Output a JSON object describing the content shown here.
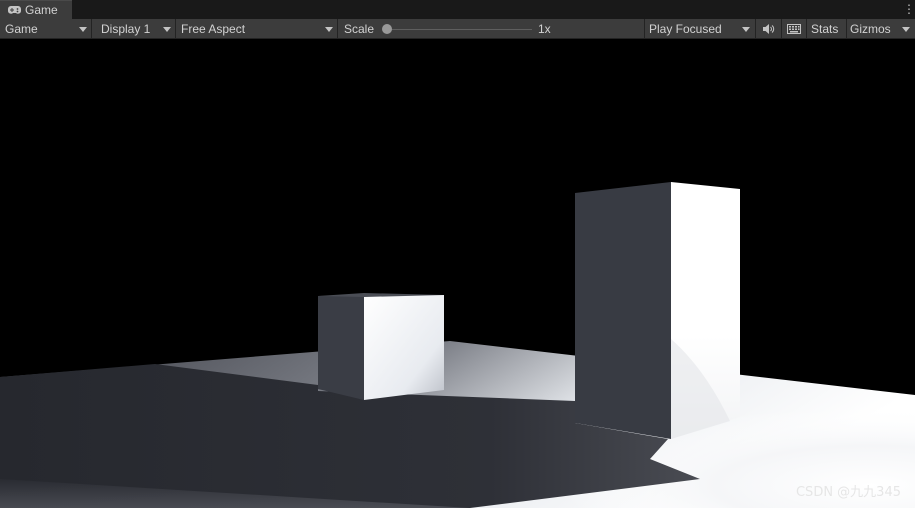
{
  "tab": {
    "title": "Game",
    "icon": "gamepad-icon"
  },
  "toolbar": {
    "mode": "Game",
    "display": "Display 1",
    "aspect": "Free Aspect",
    "scale_label": "Scale",
    "scale_value": "1x",
    "play_mode": "Play Focused",
    "stats": "Stats",
    "gizmos": "Gizmos"
  },
  "scene": {
    "sky_color": "#000000",
    "floor_light": "#ffffff",
    "shadow_color": "#2a2c33",
    "cube_dark_face": "#3a3d45",
    "cube_lit_face": "#ffffff"
  },
  "watermark": "CSDN @九九345"
}
